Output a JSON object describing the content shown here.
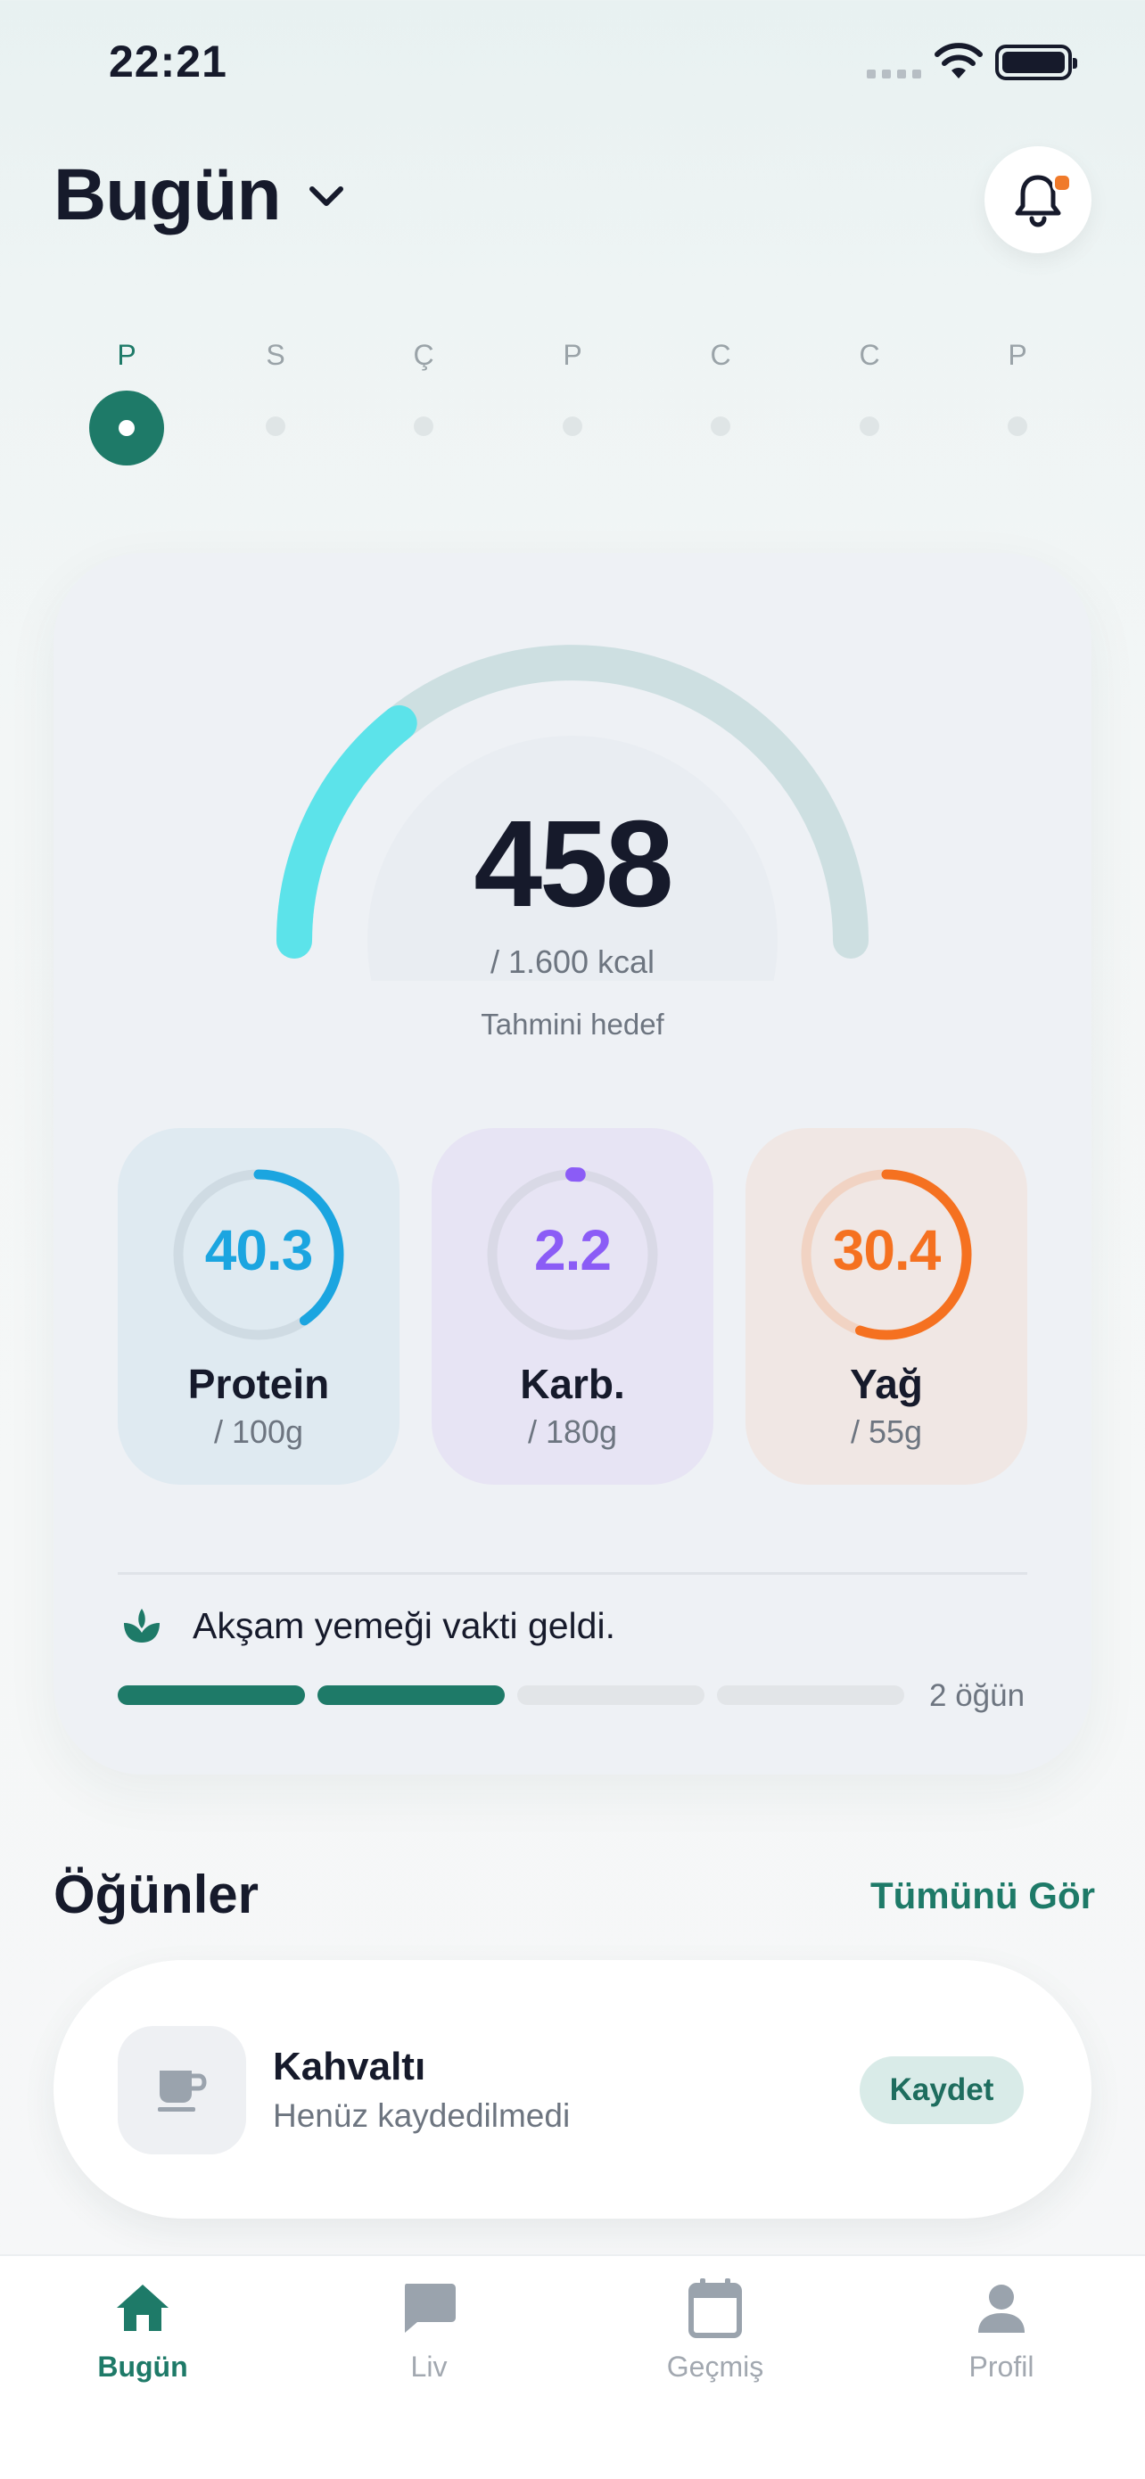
{
  "status_bar": {
    "time": "22:21",
    "icons": [
      "signal-icon",
      "wifi-icon",
      "battery-icon"
    ]
  },
  "header": {
    "title": "Bugün",
    "dropdown_icon": "chevron-down-icon",
    "notification_icon": "bell-icon"
  },
  "week": {
    "days": [
      "P",
      "S",
      "Ç",
      "P",
      "C",
      "C",
      "P"
    ],
    "active_index": 0
  },
  "summary": {
    "calories": "458",
    "calories_goal": "/ 1.600 kcal",
    "caption": "Tahmini hedef",
    "progress_fraction": 0.286,
    "macros": [
      {
        "value": "40.3",
        "name": "Protein",
        "goal": "/ 100g",
        "color": "#1ba5e0",
        "fraction": 0.403
      },
      {
        "value": "2.2",
        "name": "Karb.",
        "goal": "/ 180g",
        "color": "#8b5cf6",
        "fraction": 0.012
      },
      {
        "value": "30.4",
        "name": "Yağ",
        "goal": "/ 55g",
        "color": "#f57120",
        "fraction": 0.553
      }
    ],
    "meal_message": "Akşam yemeği vakti geldi.",
    "meal_progress": {
      "done": 2,
      "total": 4
    },
    "meal_count": "2 öğün"
  },
  "meals_section": {
    "title": "Öğünler",
    "see_all": "Tümünü Gör",
    "items": [
      {
        "name": "Kahvaltı",
        "status": "Henüz kaydedilmedi",
        "action": "Kaydet",
        "icon": "coffee-cup-icon"
      }
    ]
  },
  "tabs": [
    {
      "label": "Bugün",
      "icon": "home-icon",
      "active": true
    },
    {
      "label": "Liv",
      "icon": "chat-icon",
      "active": false
    },
    {
      "label": "Geçmiş",
      "icon": "calendar-icon",
      "active": false
    },
    {
      "label": "Profil",
      "icon": "person-icon",
      "active": false
    }
  ],
  "colors": {
    "accent": "#1e7a68",
    "gauge": "#5ce3ea",
    "gauge_track": "#cddfe1"
  }
}
